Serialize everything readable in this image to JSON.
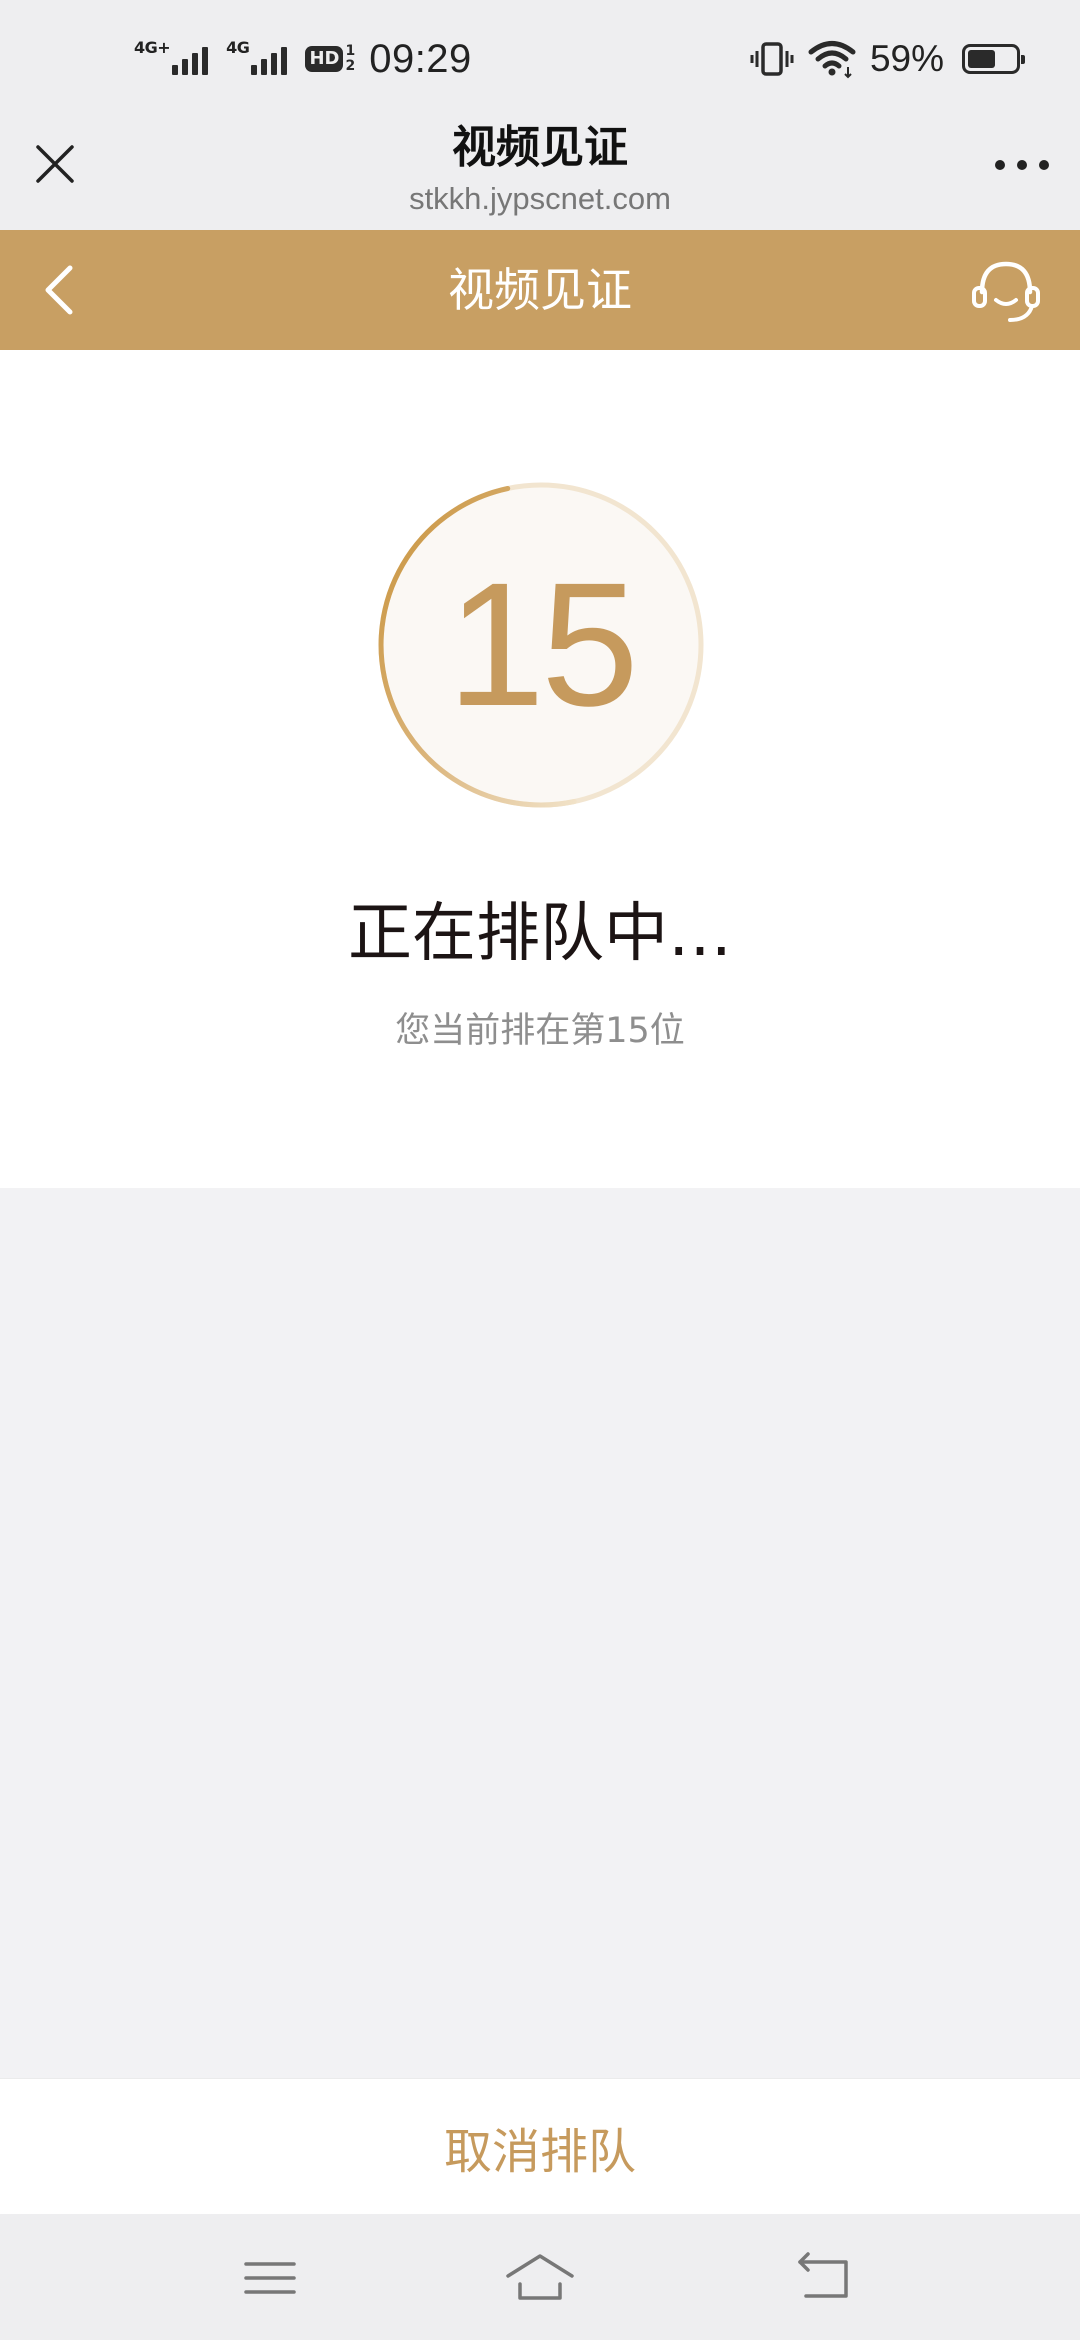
{
  "status_bar": {
    "network_1": "4G+",
    "network_2": "4G",
    "hd_label": "HD",
    "hd_sim_top": "1",
    "hd_sim_bottom": "2",
    "time": "09:29",
    "battery_percent": "59%",
    "battery_level": 0.59,
    "icons": [
      "vibrate-icon",
      "wifi-icon",
      "battery-icon"
    ]
  },
  "browser": {
    "title": "视频见证",
    "url": "stkkh.jypscnet.com",
    "close_icon": "close-icon",
    "more_icon": "more-icon"
  },
  "header": {
    "title": "视频见证",
    "back_icon": "back-icon",
    "support_icon": "headset-icon"
  },
  "queue": {
    "position_number": "15",
    "progress_fraction": 0.5,
    "status_text": "正在排队中…",
    "position_text": "您当前排在第15位"
  },
  "footer": {
    "cancel_label": "取消排队"
  },
  "system_nav": {
    "icons": [
      "menu-icon",
      "home-icon",
      "back-nav-icon"
    ]
  },
  "colors": {
    "accent": "#c89f63",
    "accent_text": "#c69a5d",
    "ring_track": "#f2e5d0",
    "circle_fill": "#fbf8f4",
    "page_bg": "#f2f2f4",
    "panel_bg": "#ffffff"
  }
}
